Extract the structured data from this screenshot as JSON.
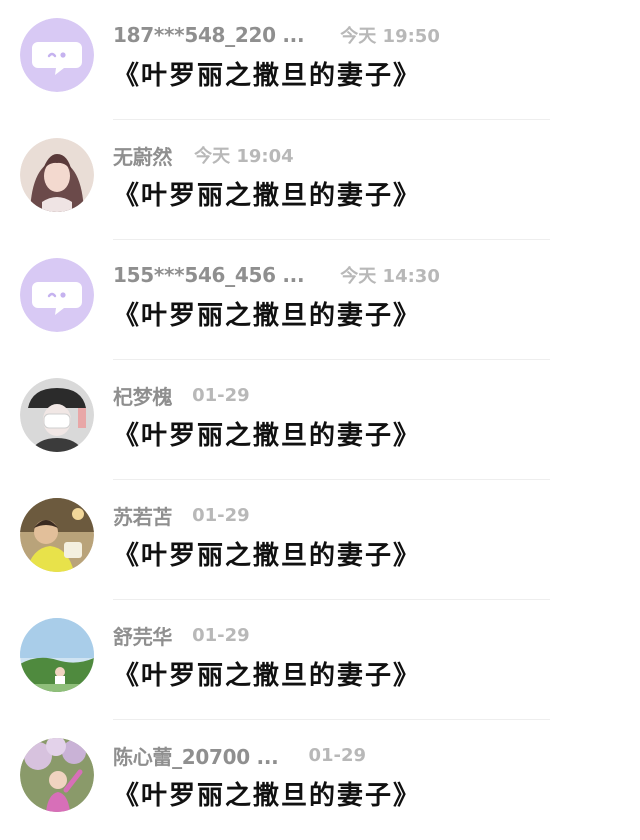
{
  "conversations": [
    {
      "name": "187***548_220 ...",
      "time": "今天 19:50",
      "message": "《叶罗丽之撒旦的妻子》",
      "avatar_icon": "default-chat-avatar-icon",
      "avatar_color": "#d8c9f4"
    },
    {
      "name": "无蔚然",
      "time": "今天 19:04",
      "message": "《叶罗丽之撒旦的妻子》",
      "avatar_icon": "user-photo-avatar",
      "avatar_color": "#6b4a4a"
    },
    {
      "name": "155***546_456 ...",
      "time": "今天 14:30",
      "message": "《叶罗丽之撒旦的妻子》",
      "avatar_icon": "default-chat-avatar-icon",
      "avatar_color": "#d8c9f4"
    },
    {
      "name": "杞梦槐",
      "time": "01-29",
      "message": "《叶罗丽之撒旦的妻子》",
      "avatar_icon": "user-photo-avatar",
      "avatar_color": "#3b3b3b"
    },
    {
      "name": "苏若苫",
      "time": "01-29",
      "message": "《叶罗丽之撒旦的妻子》",
      "avatar_icon": "user-photo-avatar",
      "avatar_color": "#b9a37a"
    },
    {
      "name": "舒芫华",
      "time": "01-29",
      "message": "《叶罗丽之撒旦的妻子》",
      "avatar_icon": "user-photo-avatar",
      "avatar_color": "#9fc6e6"
    },
    {
      "name": "陈心蕾_20700 ...",
      "time": "01-29",
      "message": "《叶罗丽之撒旦的妻子》",
      "avatar_icon": "user-photo-avatar",
      "avatar_color": "#8a9a6a"
    }
  ]
}
